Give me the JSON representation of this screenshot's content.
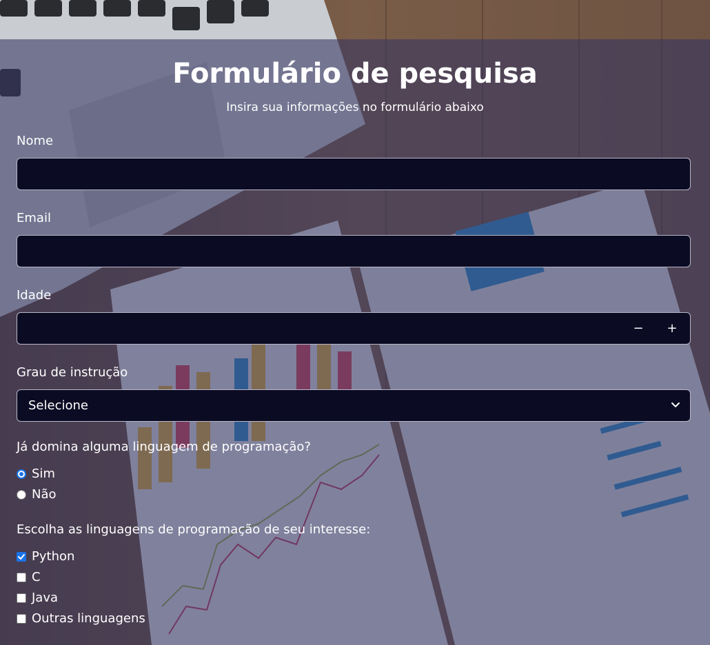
{
  "page": {
    "title": "Formulário de pesquisa",
    "subtitle": "Insira sua informações no formulário abaixo"
  },
  "fields": {
    "name": {
      "label": "Nome",
      "value": ""
    },
    "email": {
      "label": "Email",
      "value": ""
    },
    "age": {
      "label": "Idade",
      "value": "",
      "decrement": "−",
      "increment": "+"
    },
    "education": {
      "label": "Grau de instrução",
      "selected": "Selecione"
    }
  },
  "knows_programming": {
    "question": "Já domina alguma linguagem de programação?",
    "options": [
      {
        "label": "Sim",
        "selected": true
      },
      {
        "label": "Não",
        "selected": false
      }
    ]
  },
  "languages": {
    "question": "Escolha as linguagens de programação de seu interesse:",
    "options": [
      {
        "label": "Python",
        "checked": true
      },
      {
        "label": "C",
        "checked": false
      },
      {
        "label": "Java",
        "checked": false
      },
      {
        "label": "Outras linguagens",
        "checked": false
      }
    ]
  },
  "colors": {
    "overlay": "#363662",
    "field_background": "#0c0b24",
    "accent": "#1a73e8"
  }
}
